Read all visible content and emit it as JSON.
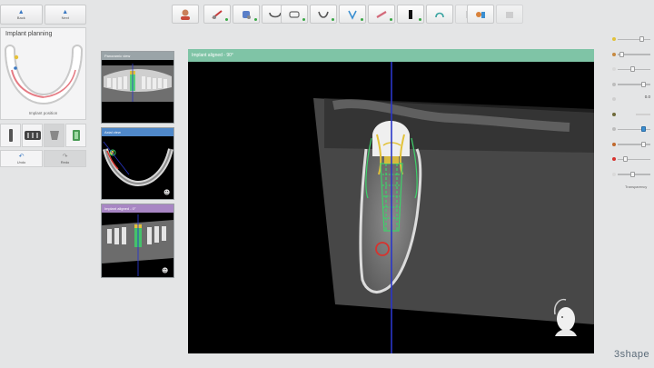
{
  "nav": {
    "back_label": "Back",
    "next_label": "Next"
  },
  "planning": {
    "title": "Implant planning",
    "caption": "Implant position"
  },
  "tool_row": {
    "icons": [
      "implant-icon",
      "crown-bridge-icon",
      "abutment-icon",
      "guide-sleeve-icon"
    ]
  },
  "bottom_buttons": {
    "undo_label": "Undo",
    "redo_label": "Redo"
  },
  "toolbar": {
    "icons": [
      "patient-icon",
      "segment-icon",
      "tooth-select-icon",
      "arch-icon",
      "panoramic-curve-icon",
      "crown-wax-icon",
      "nerve-mark-icon",
      "implant-tool-icon",
      "white-implant-icon",
      "sleeve-icon",
      "spacer-icon",
      "transfer-icon",
      "export-icon"
    ]
  },
  "thumbnails": {
    "panoramic_title": "Panoramic view",
    "axial_title": "Axial view",
    "aligned_title": "Implant aligned - 0°"
  },
  "main_view": {
    "title": "Implant aligned - 90°"
  },
  "sliders": {
    "values": [
      "",
      "",
      "",
      "",
      "",
      "0.0",
      "",
      "",
      "",
      "",
      ""
    ],
    "footer": "Transparency"
  },
  "brand": "3shape",
  "colors": {
    "main_header": "#7fc4a6",
    "axial_header": "#4f88c9",
    "aligned_header": "#a886c4",
    "implant_green": "#3ed16a",
    "crown_yellow": "#e2c23a",
    "nerve_red": "#d7332e",
    "guide_blue": "#2a36c9"
  }
}
